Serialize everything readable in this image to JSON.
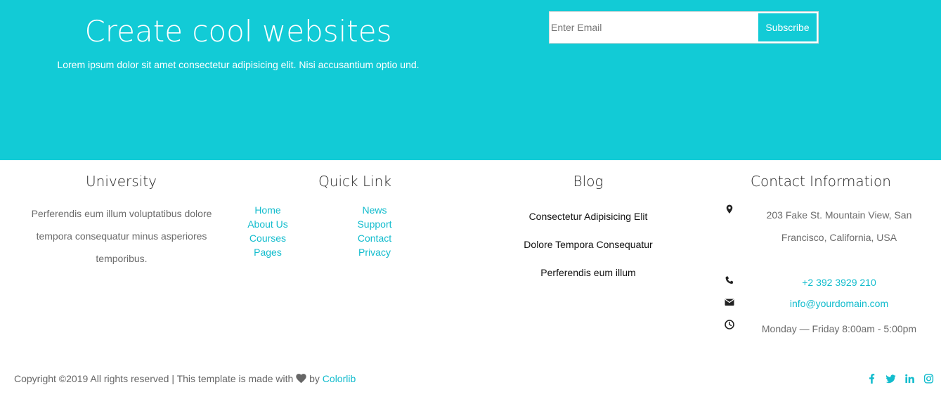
{
  "hero": {
    "title": "Create cool websites",
    "subtitle": "Lorem ipsum dolor sit amet consectetur adipisicing elit. Nisi accusantium optio und.",
    "email_placeholder": "Enter Email",
    "subscribe_label": "Subscribe"
  },
  "university": {
    "title": "University",
    "text": "Perferendis eum illum voluptatibus dolore tempora consequatur minus asperiores temporibus."
  },
  "quick_link": {
    "title": "Quick Link",
    "col1": [
      "Home",
      "About Us",
      "Courses",
      "Pages"
    ],
    "col2": [
      "News",
      "Support",
      "Contact",
      "Privacy"
    ]
  },
  "blog": {
    "title": "Blog",
    "posts": [
      "Consectetur Adipisicing Elit",
      "Dolore Tempora Consequatur",
      "Perferendis eum illum"
    ]
  },
  "contact": {
    "title": "Contact Information",
    "address": "203 Fake St. Mountain View, San Francisco, California, USA",
    "phone": "+2 392 3929 210",
    "email": "info@yourdomain.com",
    "hours": "Monday — Friday 8:00am - 5:00pm"
  },
  "footer": {
    "copy_prefix": "Copyright ©2019 All rights reserved | This template is made with",
    "by": "by",
    "author": "Colorlib",
    "social_icons": [
      "facebook-icon",
      "twitter-icon",
      "linkedin-icon",
      "instagram-icon"
    ]
  },
  "colors": {
    "accent": "#12cbd6",
    "link": "#12bccd"
  }
}
